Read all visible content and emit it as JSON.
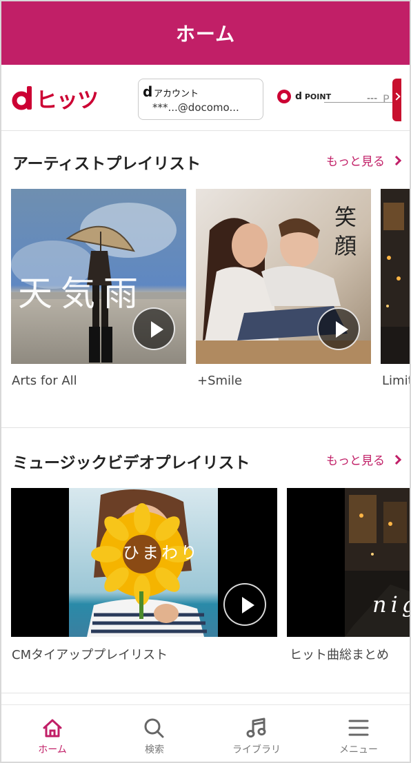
{
  "header": {
    "title": "ホーム"
  },
  "account_bar": {
    "logo_text": "ヒッツ",
    "account_label": "アカウント",
    "account_value": "***...@docomo...",
    "dpoint_label": "POINT",
    "point_value": "---",
    "point_unit": "P"
  },
  "artist_section": {
    "title": "アーティストプレイリスト",
    "more_label": "もっと見る",
    "items": [
      {
        "caption": "Arts for All",
        "overlay": "天気雨"
      },
      {
        "caption": "+Smile",
        "overlay": "笑顔"
      },
      {
        "caption": "Limit"
      }
    ]
  },
  "mv_section": {
    "title": "ミュージックビデオプレイリスト",
    "more_label": "もっと見る",
    "items": [
      {
        "caption": "CMタイアッププレイリスト",
        "overlay": "ひまわり"
      },
      {
        "caption": "ヒット曲総まとめ",
        "overlay": "nig"
      }
    ]
  },
  "tabbar": {
    "items": [
      {
        "label": "ホーム",
        "icon": "home-icon",
        "active": true
      },
      {
        "label": "検索",
        "icon": "search-icon",
        "active": false
      },
      {
        "label": "ライブラリ",
        "icon": "music-note-icon",
        "active": false
      },
      {
        "label": "メニュー",
        "icon": "hamburger-menu-icon",
        "active": false
      }
    ]
  },
  "colors": {
    "accent": "#c11f67",
    "logo_red": "#cc0033"
  }
}
